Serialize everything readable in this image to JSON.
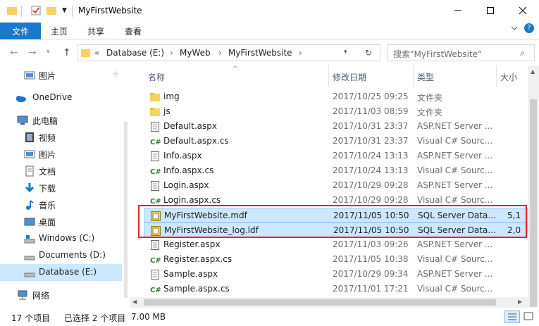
{
  "window": {
    "title": "MyFirstWebsite",
    "controls": {
      "minimize": "—",
      "maximize": "☐",
      "close": "✕"
    }
  },
  "ribbon": {
    "tabs": [
      "文件",
      "主页",
      "共享",
      "查看"
    ],
    "expand_icon": "chevron-down",
    "help_icon": "?"
  },
  "address": {
    "prefix": "«",
    "breadcrumbs": [
      "Database (E:)",
      "MyWeb",
      "MyFirstWebsite"
    ],
    "search_placeholder": "搜索\"MyFirstWebsite\""
  },
  "nav": {
    "items": [
      {
        "label": "图片",
        "icon": "pictures-icon",
        "pinned": true
      },
      {
        "label": "OneDrive",
        "icon": "onedrive-icon"
      },
      {
        "label": "此电脑",
        "icon": "computer-icon"
      },
      {
        "label": "视频",
        "icon": "videos-icon"
      },
      {
        "label": "图片",
        "icon": "pictures-icon"
      },
      {
        "label": "文档",
        "icon": "documents-icon"
      },
      {
        "label": "下载",
        "icon": "download-icon"
      },
      {
        "label": "音乐",
        "icon": "music-icon"
      },
      {
        "label": "桌面",
        "icon": "desktop-icon"
      },
      {
        "label": "Windows (C:)",
        "icon": "drive-icon"
      },
      {
        "label": "Documents (D:)",
        "icon": "drive-icon"
      },
      {
        "label": "Database (E:)",
        "icon": "drive-icon",
        "selected": true
      },
      {
        "label": "网络",
        "icon": "network-icon"
      }
    ]
  },
  "columns": {
    "name": "名称",
    "date": "修改日期",
    "type": "类型",
    "size": "大小"
  },
  "files": [
    {
      "name": "img",
      "date": "2017/10/25 09:25",
      "type": "文件夹",
      "size": "",
      "icon": "folder-icon"
    },
    {
      "name": "js",
      "date": "2017/11/03 08:59",
      "type": "文件夹",
      "size": "",
      "icon": "folder-icon"
    },
    {
      "name": "Default.aspx",
      "date": "2017/10/31 23:37",
      "type": "ASP.NET Server ...",
      "size": "",
      "icon": "aspx-file-icon"
    },
    {
      "name": "Default.aspx.cs",
      "date": "2017/10/31 23:37",
      "type": "Visual C# Sourc...",
      "size": "",
      "icon": "csharp-file-icon"
    },
    {
      "name": "Info.aspx",
      "date": "2017/10/24 13:13",
      "type": "ASP.NET Server ...",
      "size": "",
      "icon": "aspx-file-icon"
    },
    {
      "name": "Info.aspx.cs",
      "date": "2017/10/24 13:13",
      "type": "Visual C# Sourc...",
      "size": "",
      "icon": "csharp-file-icon"
    },
    {
      "name": "Login.aspx",
      "date": "2017/10/29 09:28",
      "type": "ASP.NET Server ...",
      "size": "",
      "icon": "aspx-file-icon"
    },
    {
      "name": "Login.aspx.cs",
      "date": "2017/10/29 09:28",
      "type": "Visual C# Sourc...",
      "size": "",
      "icon": "csharp-file-icon"
    },
    {
      "name": "MyFirstWebsite.mdf",
      "date": "2017/11/05 10:50",
      "type": "SQL Server Data...",
      "size": "5,1",
      "icon": "database-file-icon",
      "selected": true
    },
    {
      "name": "MyFirstWebsite_log.ldf",
      "date": "2017/11/05 10:50",
      "type": "SQL Server Data...",
      "size": "2,0",
      "icon": "database-file-icon",
      "selected": true
    },
    {
      "name": "Register.aspx",
      "date": "2017/11/03 09:26",
      "type": "ASP.NET Server ...",
      "size": "",
      "icon": "aspx-file-icon"
    },
    {
      "name": "Register.aspx.cs",
      "date": "2017/11/05 10:38",
      "type": "Visual C# Sourc...",
      "size": "",
      "icon": "csharp-file-icon"
    },
    {
      "name": "Sample.aspx",
      "date": "2017/10/29 09:34",
      "type": "ASP.NET Server ...",
      "size": "",
      "icon": "aspx-file-icon"
    },
    {
      "name": "Sample.aspx.cs",
      "date": "2017/11/01 17:21",
      "type": "Visual C# Sourc...",
      "size": "",
      "icon": "csharp-file-icon"
    }
  ],
  "status": {
    "count": "17 个项目",
    "selection": "已选择 2 个项目",
    "size": "7.00 MB"
  },
  "colors": {
    "accent": "#1979ca",
    "selection": "#cce8ff",
    "highlight_box": "#e8232a"
  }
}
